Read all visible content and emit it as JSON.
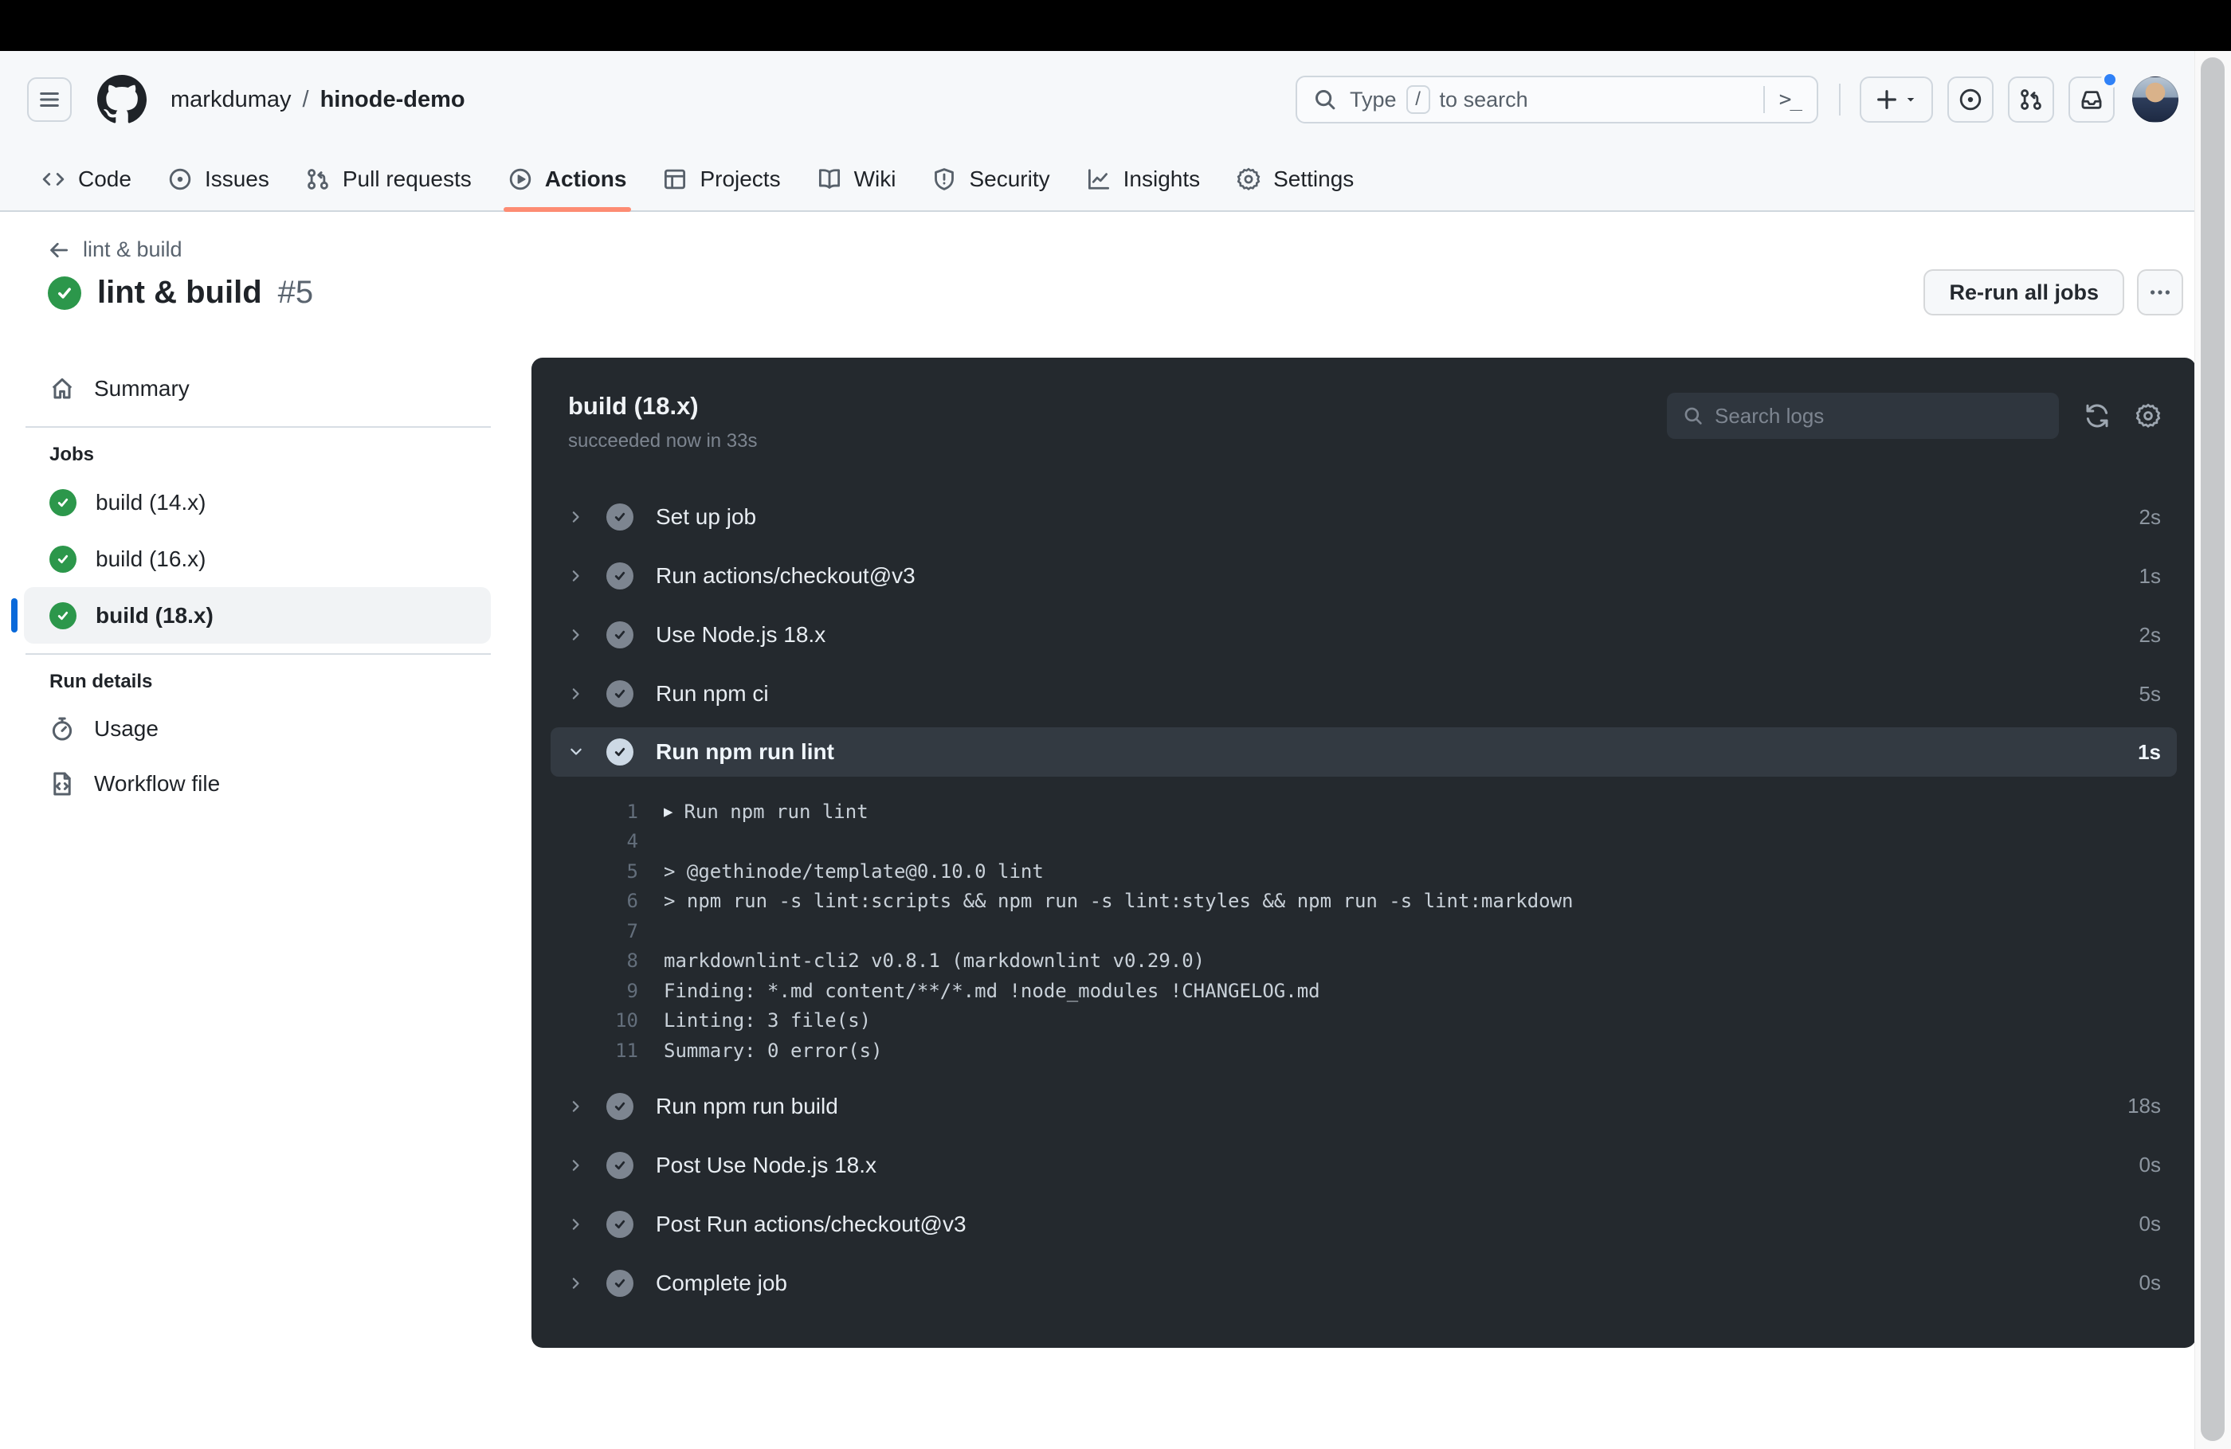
{
  "colors": {
    "header_bg": "#f6f8fa",
    "border": "#d0d7de",
    "text": "#1f2328",
    "muted_text": "#59636e",
    "active_tab_underline": "#fd8c73",
    "success_green": "#2c974b",
    "selected_job_bar_blue": "#0969da",
    "notification_dot_blue": "#2f81f7",
    "panel_bg": "#24292e",
    "panel_highlight_row": "#333a42",
    "panel_muted": "#7d8590",
    "log_text": "#c9d1d9",
    "log_line_number": "#636e7b"
  },
  "header": {
    "owner": "markdumay",
    "separator": "/",
    "repo": "hinode-demo",
    "search": {
      "prefix": "Type",
      "key": "/",
      "suffix": "to search"
    }
  },
  "nav": {
    "tabs": [
      {
        "label": "Code"
      },
      {
        "label": "Issues"
      },
      {
        "label": "Pull requests"
      },
      {
        "label": "Actions",
        "active": true
      },
      {
        "label": "Projects"
      },
      {
        "label": "Wiki"
      },
      {
        "label": "Security"
      },
      {
        "label": "Insights"
      },
      {
        "label": "Settings"
      }
    ]
  },
  "run": {
    "breadcrumb": "lint & build",
    "title": "lint & build",
    "number": "#5",
    "rerun_label": "Re-run all jobs"
  },
  "sidebar": {
    "summary": "Summary",
    "jobs_heading": "Jobs",
    "jobs": [
      {
        "label": "build (14.x)",
        "status": "success"
      },
      {
        "label": "build (16.x)",
        "status": "success"
      },
      {
        "label": "build (18.x)",
        "status": "success",
        "selected": true
      }
    ],
    "details_heading": "Run details",
    "usage": "Usage",
    "workflow_file": "Workflow file"
  },
  "panel": {
    "title": "build (18.x)",
    "subtitle": "succeeded now in 33s",
    "search_placeholder": "Search logs",
    "steps": [
      {
        "label": "Set up job",
        "duration": "2s"
      },
      {
        "label": "Run actions/checkout@v3",
        "duration": "1s"
      },
      {
        "label": "Use Node.js 18.x",
        "duration": "2s"
      },
      {
        "label": "Run npm ci",
        "duration": "5s"
      },
      {
        "label": "Run npm run lint",
        "duration": "1s",
        "expanded": true
      },
      {
        "label": "Run npm run build",
        "duration": "18s"
      },
      {
        "label": "Post Use Node.js 18.x",
        "duration": "0s"
      },
      {
        "label": "Post Run actions/checkout@v3",
        "duration": "0s"
      },
      {
        "label": "Complete job",
        "duration": "0s"
      }
    ],
    "log_lines": [
      {
        "num": "1",
        "marker": "▶",
        "text": "Run npm run lint"
      },
      {
        "num": "4",
        "text": ""
      },
      {
        "num": "5",
        "text": "> @gethinode/template@0.10.0 lint"
      },
      {
        "num": "6",
        "text": "> npm run -s lint:scripts && npm run -s lint:styles && npm run -s lint:markdown"
      },
      {
        "num": "7",
        "text": ""
      },
      {
        "num": "8",
        "text": "markdownlint-cli2 v0.8.1 (markdownlint v0.29.0)"
      },
      {
        "num": "9",
        "text": "Finding: *.md content/**/*.md !node_modules !CHANGELOG.md"
      },
      {
        "num": "10",
        "text": "Linting: 3 file(s)"
      },
      {
        "num": "11",
        "text": "Summary: 0 error(s)"
      }
    ]
  },
  "icons": {
    "command_palette": ">_",
    "log_expand_marker": "▶"
  }
}
